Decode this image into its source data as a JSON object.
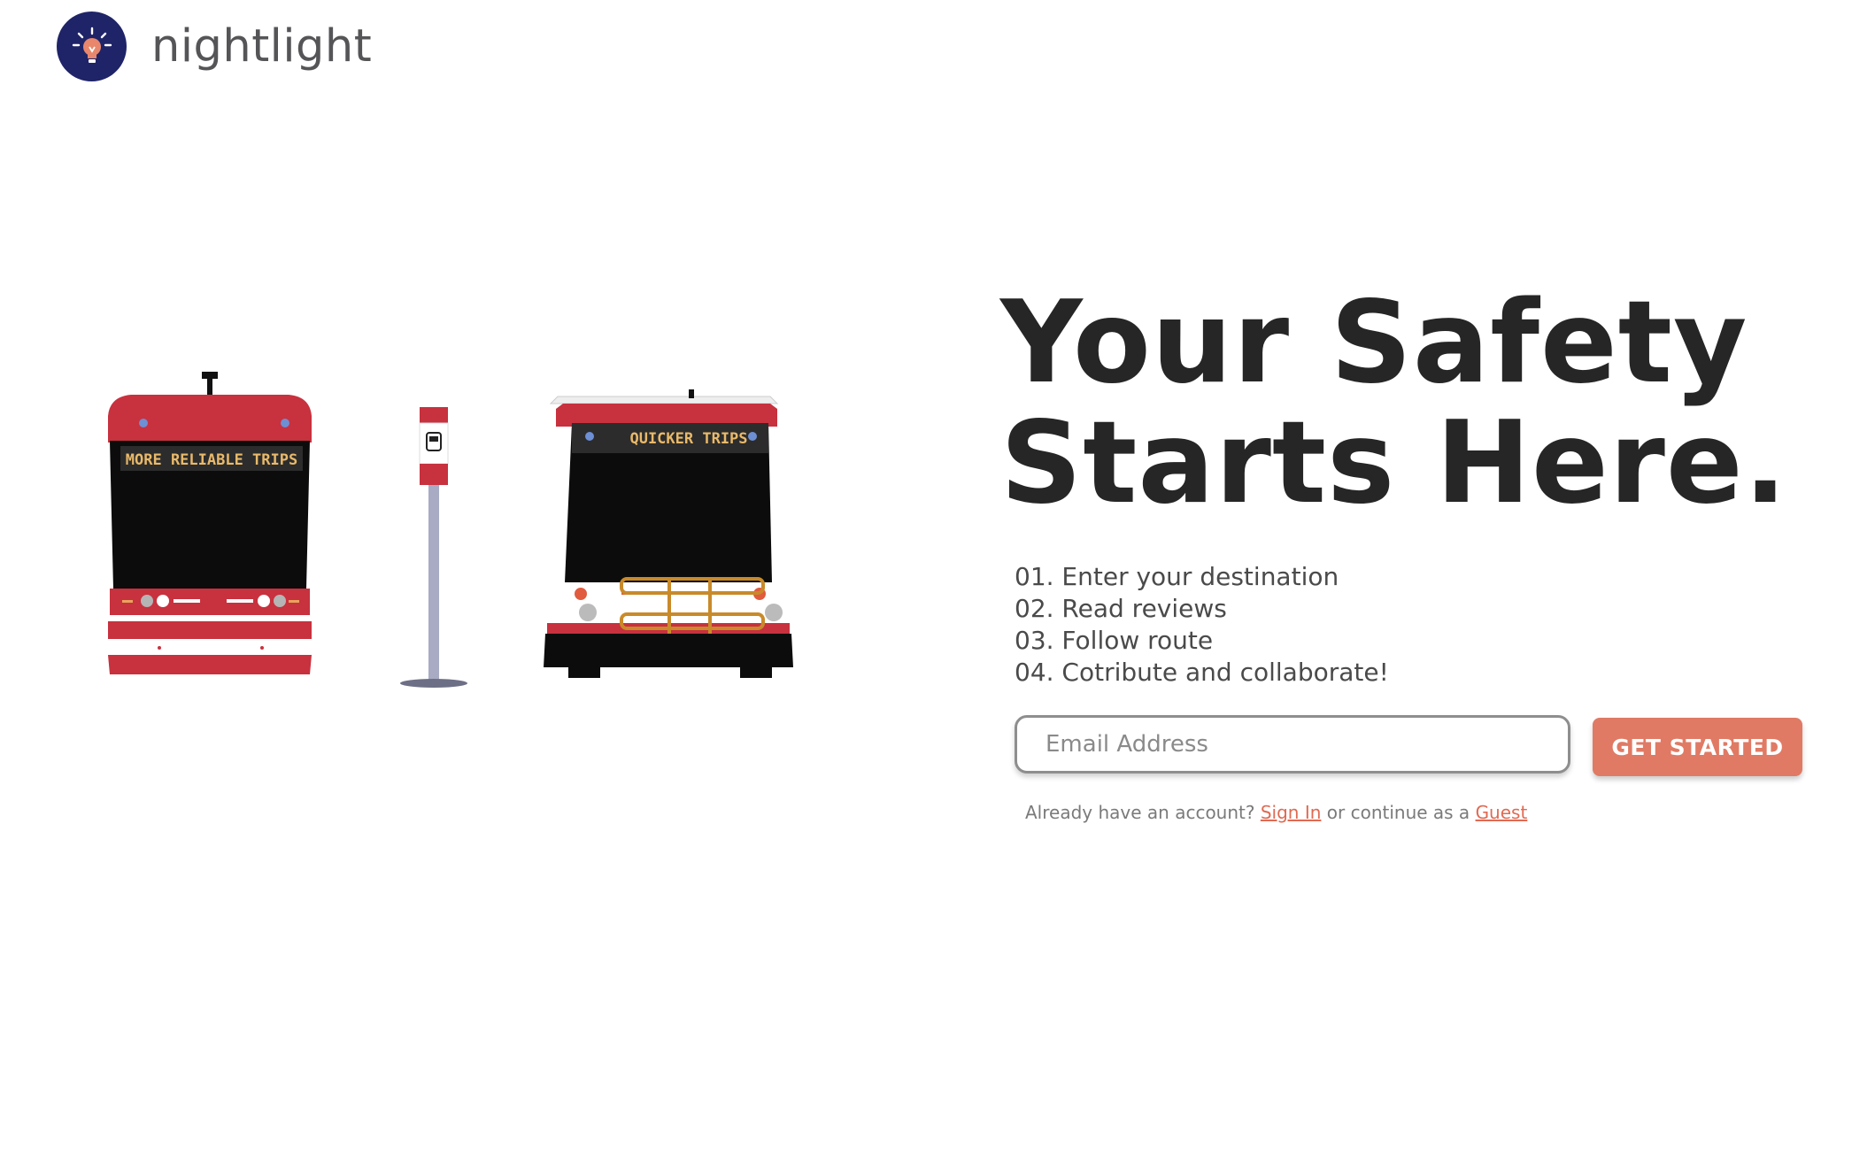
{
  "brand": {
    "name": "nightlight",
    "logo_icon": "lightbulb-icon",
    "logo_bg": "#1f2468",
    "bulb_color": "#e8876c"
  },
  "illustration": {
    "streetcar_sign": "MORE RELIABLE TRIPS",
    "bus_sign": "QUICKER TRIPS",
    "stop_icon": "bus-icon",
    "transit_red": "#c8313e"
  },
  "hero": {
    "line1": "Your Safety",
    "line2": "Starts Here."
  },
  "steps": [
    "01. Enter your destination",
    "02. Read reviews",
    "03. Follow route",
    "04. Cotribute and collaborate!"
  ],
  "signup": {
    "email_placeholder": "Email Address",
    "email_value": "",
    "cta_label": "GET STARTED",
    "cta_color": "#e07a64"
  },
  "account": {
    "prompt": "Already have an account?",
    "signin_label": "Sign In",
    "middle": "or continue as a",
    "guest_label": "Guest",
    "link_color": "#e06a52"
  }
}
